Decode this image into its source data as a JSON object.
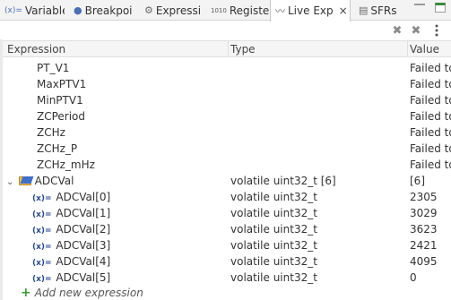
{
  "tabs": [
    {
      "label": "Variable",
      "icon": "(x)="
    },
    {
      "label": "Breakpoi",
      "icon": "●"
    },
    {
      "label": "Expressi",
      "icon": "⚙"
    },
    {
      "label": "Register",
      "icon": "1010"
    },
    {
      "label": "Live Exp",
      "icon": "〰",
      "close": "×"
    },
    {
      "label": "SFRs",
      "icon": "▤"
    }
  ],
  "columns": {
    "expression": "Expression",
    "type": "Type",
    "value": "Value"
  },
  "rows": [
    {
      "expr": "PT_V1",
      "type": "",
      "value": "Failed to"
    },
    {
      "expr": "MaxPTV1",
      "type": "",
      "value": "Failed to"
    },
    {
      "expr": "MinPTV1",
      "type": "",
      "value": "Failed to"
    },
    {
      "expr": "ZCPeriod",
      "type": "",
      "value": "Failed to"
    },
    {
      "expr": "ZCHz",
      "type": "",
      "value": "Failed to"
    },
    {
      "expr": "ZCHz_P",
      "type": "",
      "value": "Failed to"
    },
    {
      "expr": "ZCHz_mHz",
      "type": "",
      "value": "Failed to"
    },
    {
      "expr": "ADCVal",
      "type": "volatile uint32_t [6]",
      "value": "[6]"
    },
    {
      "expr": "ADCVal[0]",
      "type": "volatile uint32_t",
      "value": "2305"
    },
    {
      "expr": "ADCVal[1]",
      "type": "volatile uint32_t",
      "value": "3029"
    },
    {
      "expr": "ADCVal[2]",
      "type": "volatile uint32_t",
      "value": "3623"
    },
    {
      "expr": "ADCVal[3]",
      "type": "volatile uint32_t",
      "value": "2421"
    },
    {
      "expr": "ADCVal[4]",
      "type": "volatile uint32_t",
      "value": "4095"
    },
    {
      "expr": "ADCVal[5]",
      "type": "volatile uint32_t",
      "value": "0"
    }
  ],
  "add_expression": "Add new expression",
  "icons": {
    "element": "(x)=",
    "expand": "⌄",
    "add": "+"
  }
}
